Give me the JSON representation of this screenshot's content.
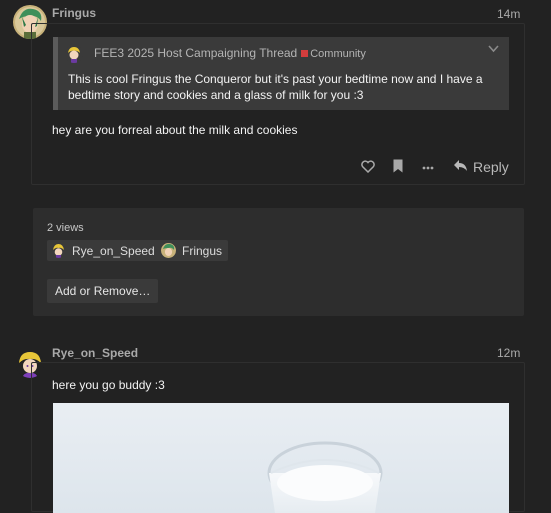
{
  "post1": {
    "username": "Fringus",
    "time": "14m",
    "quote": {
      "title": "FEE3 2025 Host Campaigning Thread",
      "category": "Community",
      "body": "This is cool Fringus the Conqueror but it's past your bedtime now and I have a bedtime story and cookies and a glass of milk for you :3"
    },
    "text": "hey are you forreal about the milk and cookies",
    "actions": {
      "like_icon": "heart-icon",
      "bookmark_icon": "bookmark-icon",
      "more_icon": "ellipsis-icon",
      "reply_label": "Reply"
    }
  },
  "views": {
    "label": "2 views",
    "users": [
      "Rye_on_Speed",
      "Fringus"
    ],
    "add_remove_label": "Add or Remove…"
  },
  "post2": {
    "username": "Rye_on_Speed",
    "time": "12m",
    "text": "here you go buddy :3"
  },
  "colors": {
    "background": "#222222",
    "category": "#d33d3d",
    "panel": "#2d2d2d"
  }
}
